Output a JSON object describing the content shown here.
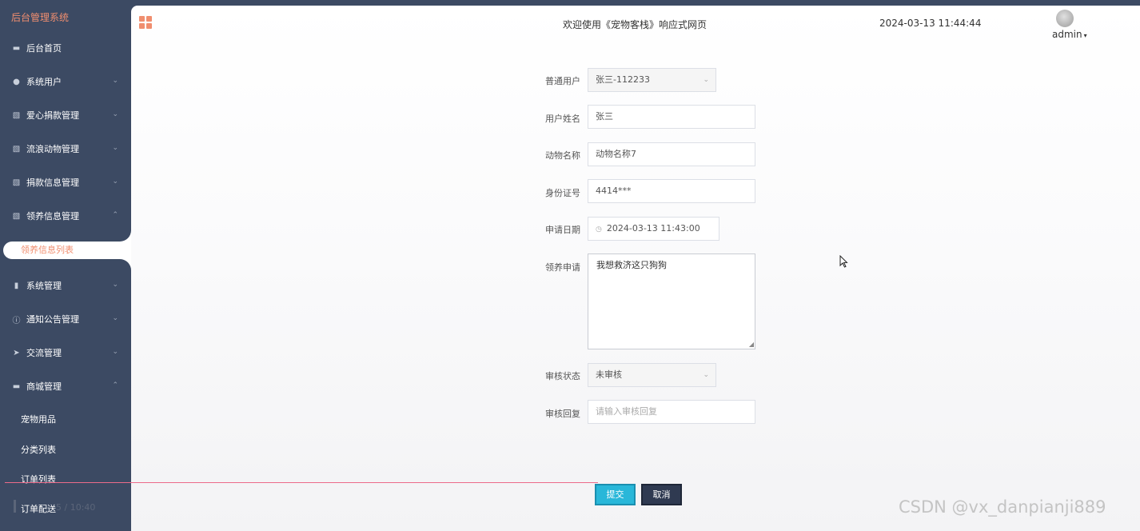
{
  "sidebar": {
    "title": "后台管理系统",
    "items": [
      {
        "label": "后台首页",
        "icon": "monitor-icon",
        "glyph": "▬",
        "chev": ""
      },
      {
        "label": "系统用户",
        "icon": "user-icon",
        "glyph": "●",
        "chev": "⌄"
      },
      {
        "label": "爱心捐款管理",
        "icon": "chart-icon",
        "glyph": "▧",
        "chev": "⌄"
      },
      {
        "label": "流浪动物管理",
        "icon": "chart-icon",
        "glyph": "▧",
        "chev": "⌄"
      },
      {
        "label": "捐款信息管理",
        "icon": "chart-icon",
        "glyph": "▧",
        "chev": "⌄"
      },
      {
        "label": "领养信息管理",
        "icon": "chart-icon",
        "glyph": "▧",
        "chev": "⌃"
      },
      {
        "label": "系统管理",
        "icon": "bar-chart-icon",
        "glyph": "▮",
        "chev": "⌄"
      },
      {
        "label": "通知公告管理",
        "icon": "info-icon",
        "glyph": "ⓘ",
        "chev": "⌄"
      },
      {
        "label": "交流管理",
        "icon": "send-icon",
        "glyph": "➤",
        "chev": "⌄"
      },
      {
        "label": "商城管理",
        "icon": "shop-icon",
        "glyph": "▬",
        "chev": "⌃"
      }
    ],
    "active_sub": "领养信息列表",
    "shop_subs": [
      "宠物用品",
      "分类列表",
      "订单列表",
      "订单配送"
    ]
  },
  "topbar": {
    "welcome": "欢迎使用《宠物客栈》响应式网页",
    "datetime": "2024-03-13 11:44:44",
    "user": "admin",
    "caret": "▾"
  },
  "form": {
    "user_label": "普通用户",
    "user_value": "张三-112233",
    "name_label": "用户姓名",
    "name_value": "张三",
    "animal_label": "动物名称",
    "animal_value": "动物名称7",
    "id_label": "身份证号",
    "id_value": "4414***",
    "date_label": "申请日期",
    "date_value": "2024-03-13 11:43:00",
    "apply_label": "领养申请",
    "apply_value": "我想救济这只狗狗",
    "status_label": "审核状态",
    "status_value": "未审核",
    "reply_label": "审核回复",
    "reply_placeholder": "请输入审核回复",
    "submit": "提交",
    "cancel": "取消"
  },
  "overlay": {
    "player_time": "5 / 10:40"
  },
  "watermark": "CSDN @vx_danpianji889",
  "colors": {
    "sidebar_bg": "#3c4a63",
    "accent": "#f08e6f",
    "submit": "#29b7d9",
    "cancel": "#2f3a51"
  }
}
